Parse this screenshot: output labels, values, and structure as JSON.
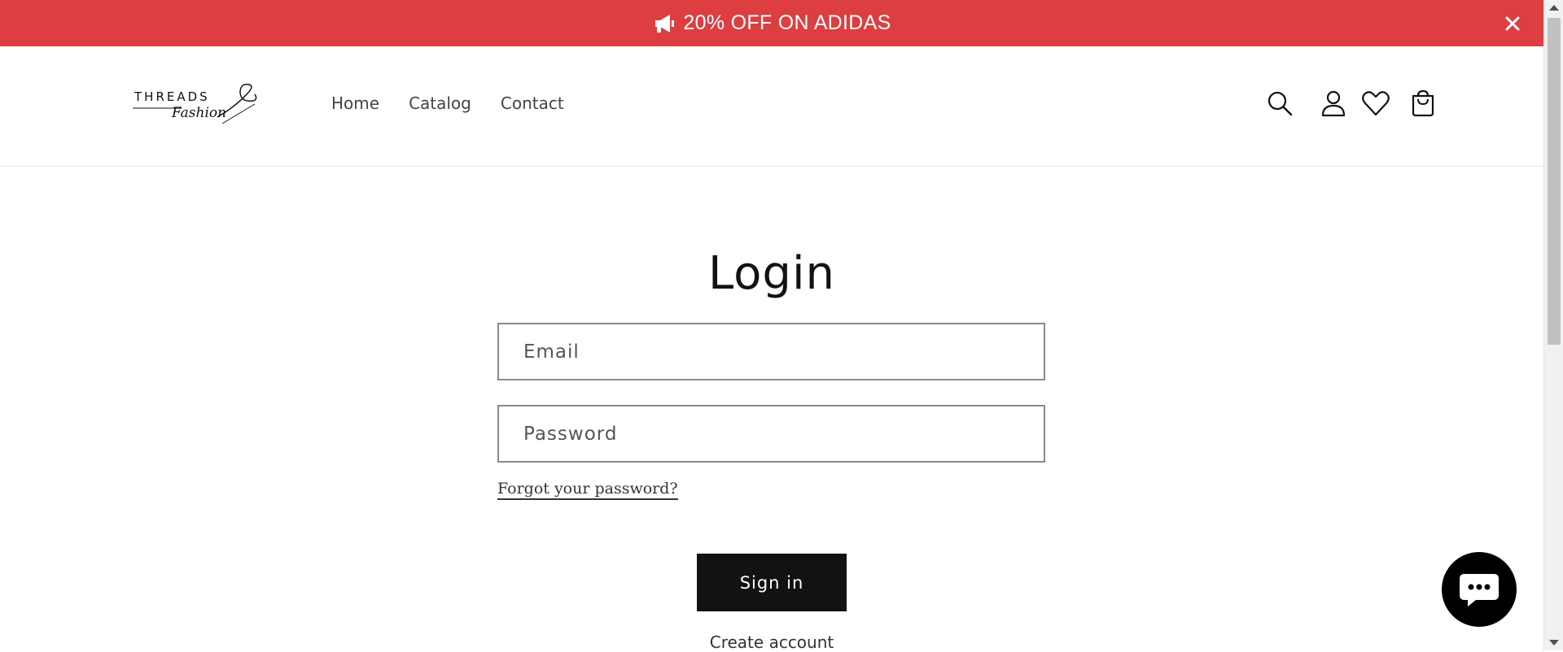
{
  "announcement": {
    "text": "20% OFF ON ADIDAS",
    "icon": "megaphone-icon",
    "close_icon": "close-icon",
    "background": "#dc3e41"
  },
  "header": {
    "logo": {
      "top_text": "THREADS",
      "script_text": "Fashion"
    },
    "nav": [
      {
        "label": "Home"
      },
      {
        "label": "Catalog"
      },
      {
        "label": "Contact"
      }
    ],
    "icons": [
      "search-icon",
      "account-icon",
      "heart-icon",
      "cart-icon"
    ]
  },
  "main": {
    "title": "Login",
    "email": {
      "placeholder": "Email",
      "value": ""
    },
    "password": {
      "placeholder": "Password",
      "value": ""
    },
    "forgot_link": "Forgot your password?",
    "signin_label": "Sign in",
    "create_account_link": "Create account"
  },
  "chat": {
    "icon": "chat-bubble-icon"
  }
}
